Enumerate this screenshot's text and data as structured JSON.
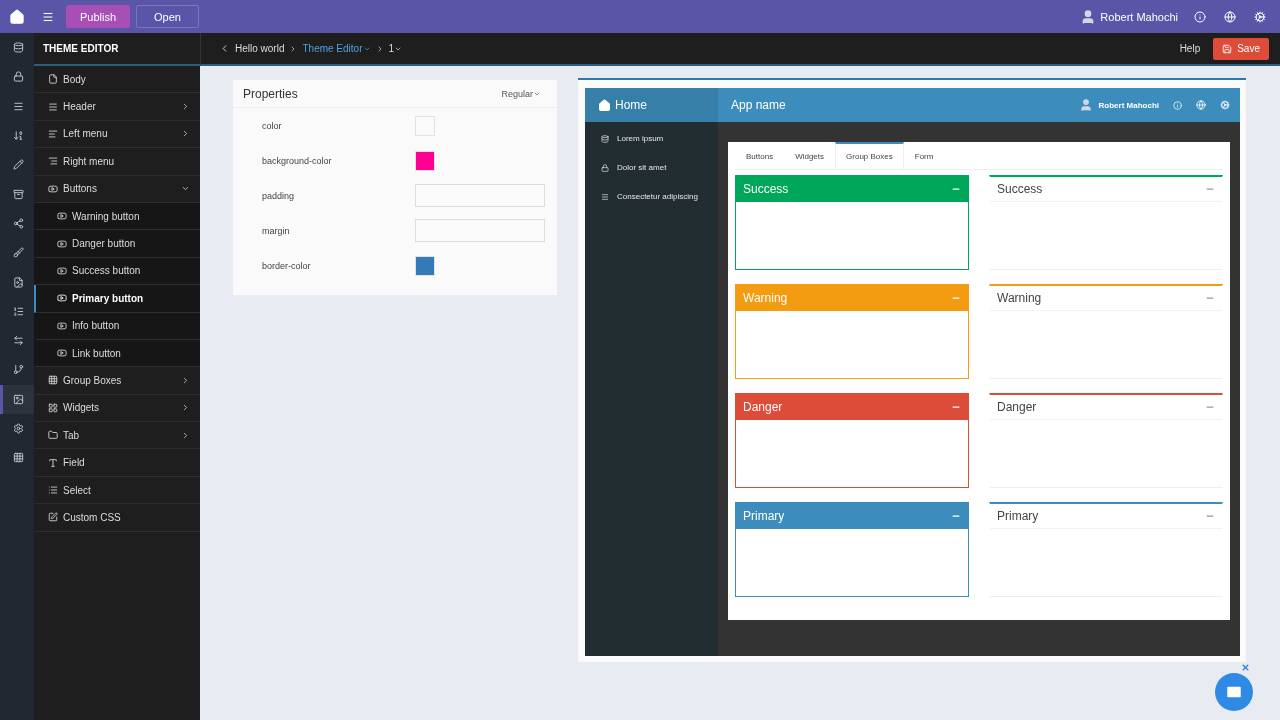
{
  "topbar": {
    "publish": "Publish",
    "open": "Open",
    "user": "Robert Mahochi"
  },
  "rail": [
    {
      "selected": false
    },
    {
      "selected": false
    },
    {
      "selected": false
    },
    {
      "selected": false
    },
    {
      "selected": false
    },
    {
      "selected": false
    },
    {
      "selected": false
    },
    {
      "selected": false
    },
    {
      "selected": false
    },
    {
      "selected": false
    },
    {
      "selected": false
    },
    {
      "selected": false
    },
    {
      "selected": true
    },
    {
      "selected": false
    },
    {
      "selected": false
    }
  ],
  "sidebar": {
    "title": "THEME EDITOR",
    "items": [
      {
        "label": "Body",
        "selected": false
      },
      {
        "label": "Header",
        "expanded": false,
        "selected": false
      },
      {
        "label": "Left menu",
        "expanded": false,
        "selected": false
      },
      {
        "label": "Right menu",
        "selected": false
      },
      {
        "label": "Buttons",
        "expanded": true,
        "selected": false,
        "children": [
          {
            "label": "Warning button",
            "selected": false
          },
          {
            "label": "Danger button",
            "selected": false
          },
          {
            "label": "Success button",
            "selected": false
          },
          {
            "label": "Primary button",
            "selected": true
          },
          {
            "label": "Info button",
            "selected": false
          },
          {
            "label": "Link button",
            "selected": false
          }
        ]
      },
      {
        "label": "Group Boxes",
        "expanded": false,
        "selected": false
      },
      {
        "label": "Widgets",
        "expanded": false,
        "selected": false
      },
      {
        "label": "Tab",
        "expanded": false,
        "selected": false
      },
      {
        "label": "Field",
        "selected": false
      },
      {
        "label": "Select",
        "selected": false
      },
      {
        "label": "Custom CSS",
        "selected": false
      }
    ]
  },
  "breadcrumb": [
    {
      "label": "Hello world",
      "dropdown": false,
      "link": false
    },
    {
      "label": "Theme Editor",
      "dropdown": true,
      "link": true
    },
    {
      "label": "1",
      "dropdown": true,
      "link": false
    }
  ],
  "actions": {
    "help": "Help",
    "save": "Save"
  },
  "properties": {
    "title": "Properties",
    "variant": "Regular",
    "rows": [
      {
        "label": "color",
        "kind": "swatch",
        "color": "#fafafa"
      },
      {
        "label": "background-color",
        "kind": "swatch",
        "color": "#ff0090"
      },
      {
        "label": "padding",
        "kind": "input"
      },
      {
        "label": "margin",
        "kind": "input"
      },
      {
        "label": "border-color",
        "kind": "swatch",
        "color": "#337ab7"
      }
    ]
  },
  "preview": {
    "home": "Home",
    "app_name": "App name",
    "user": "Robert Mahochi",
    "nav": [
      {
        "label": "Lorem ipsum"
      },
      {
        "label": "Dolor sit amet"
      },
      {
        "label": "Consectetur adipiscing"
      }
    ],
    "tabs": [
      {
        "label": "Buttons",
        "selected": false
      },
      {
        "label": "Widgets",
        "selected": false
      },
      {
        "label": "Group Boxes",
        "selected": true
      },
      {
        "label": "Form",
        "selected": false
      }
    ],
    "boxes": [
      {
        "title": "Success",
        "kind": "solid",
        "color": "#00a65a"
      },
      {
        "title": "Success",
        "kind": "outline",
        "color": "#00a65a"
      },
      {
        "title": "Warning",
        "kind": "solid",
        "color": "#f39c12"
      },
      {
        "title": "Warning",
        "kind": "outline",
        "color": "#f39c12"
      },
      {
        "title": "Danger",
        "kind": "solid",
        "color": "#dd4b39"
      },
      {
        "title": "Danger",
        "kind": "outline",
        "color": "#dd4b39"
      },
      {
        "title": "Primary",
        "kind": "solid",
        "color": "#3c8dbc"
      },
      {
        "title": "Primary",
        "kind": "outline",
        "color": "#3c8dbc"
      }
    ]
  }
}
